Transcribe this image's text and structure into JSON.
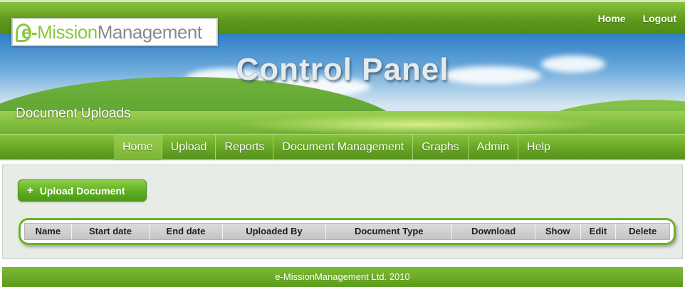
{
  "brand": {
    "logo_e": "e-",
    "logo_mission": "Mission",
    "logo_management": "Management"
  },
  "top_links": {
    "home": "Home",
    "logout": "Logout"
  },
  "banner": {
    "title": "Control Panel",
    "page_heading": "Document Uploads"
  },
  "nav": {
    "active": "Home",
    "items": [
      "Home",
      "Upload",
      "Reports",
      "Document Management",
      "Graphs",
      "Admin",
      "Help"
    ]
  },
  "actions": {
    "upload_button": "Upload Document",
    "upload_icon": "plus-icon"
  },
  "table": {
    "columns": [
      "Name",
      "Start date",
      "End date",
      "Uploaded By",
      "Document Type",
      "Download",
      "Show",
      "Edit",
      "Delete"
    ],
    "rows": []
  },
  "footer": {
    "text": "e-MissionManagement Ltd. 2010"
  },
  "colors": {
    "brand_green": "#6aa827",
    "logo_green": "#8cc63f",
    "logo_grey": "#8a8a8a"
  }
}
